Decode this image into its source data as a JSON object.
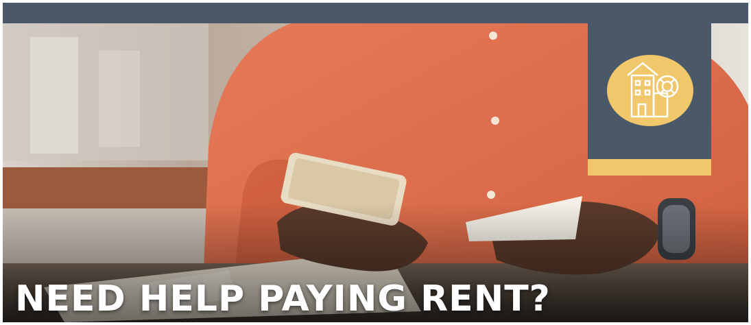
{
  "banner": {
    "headline": "NEED HELP PAYING RENT?",
    "badge_icon": "house-lifebuoy-icon",
    "colors": {
      "bar": "#4a5869",
      "accent": "#f0c76a",
      "shirt": "#e2714f",
      "text": "#ffffff"
    }
  }
}
